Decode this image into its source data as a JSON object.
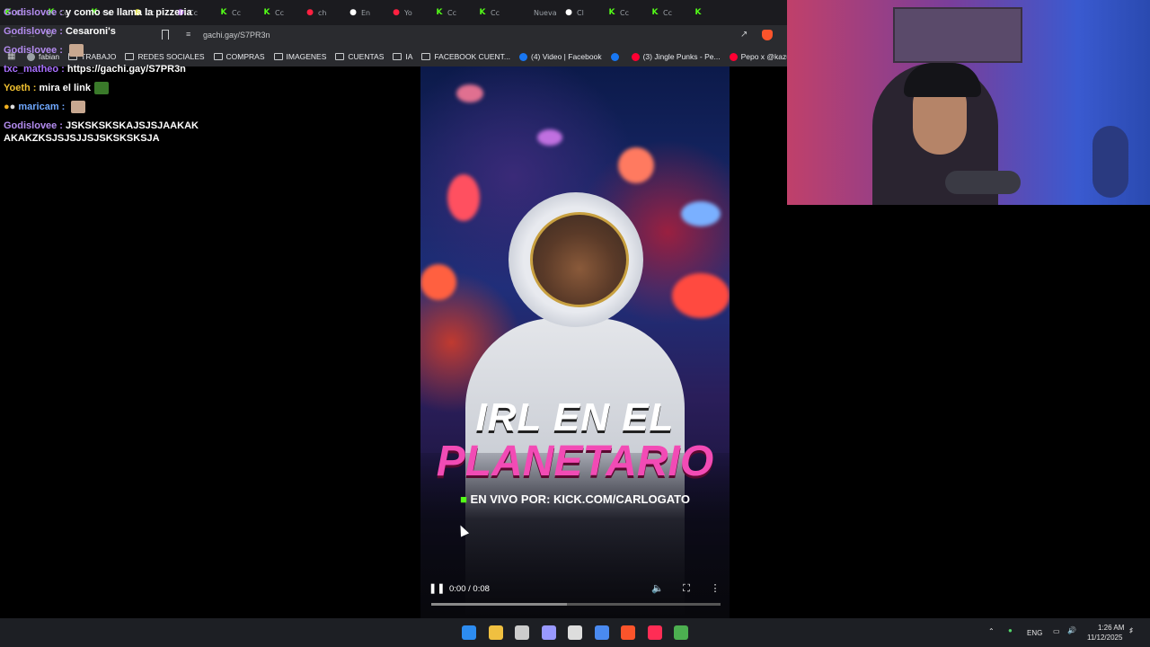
{
  "browser": {
    "tabs": [
      {
        "label": "Cc",
        "icon": "kick-icon",
        "color": "#53fc18"
      },
      {
        "label": "Cc",
        "icon": "kick-icon",
        "color": "#53fc18"
      },
      {
        "label": "Cc",
        "icon": "kick-icon",
        "color": "#53fc18"
      },
      {
        "label": "Cc",
        "icon": "star-icon",
        "color": "#e0e040"
      },
      {
        "label": "Cc",
        "icon": "feather-icon",
        "color": "#b070e0"
      },
      {
        "label": "Cc",
        "icon": "kick-icon",
        "color": "#53fc18"
      },
      {
        "label": "Cc",
        "icon": "kick-icon",
        "color": "#53fc18"
      },
      {
        "label": "ch",
        "icon": "youtube-icon",
        "color": "#ff2040"
      },
      {
        "label": "En",
        "icon": "tiktok-icon",
        "color": "#ffffff"
      },
      {
        "label": "Yo",
        "icon": "youtube-icon",
        "color": "#ff2040"
      },
      {
        "label": "Cc",
        "icon": "kick-icon",
        "color": "#53fc18"
      },
      {
        "label": "Cc",
        "icon": "kick-icon",
        "color": "#53fc18"
      },
      {
        "label": "Nueva",
        "icon": "",
        "color": "#9aa0a6"
      },
      {
        "label": "Cl",
        "icon": "chatgpt-icon",
        "color": "#ffffff"
      },
      {
        "label": "Cc",
        "icon": "kick-icon",
        "color": "#53fc18"
      },
      {
        "label": "Cc",
        "icon": "kick-icon",
        "color": "#53fc18"
      },
      {
        "label": "",
        "icon": "kick-icon",
        "color": "#53fc18"
      }
    ],
    "url": "gachi.gay/S7PR3n",
    "bookmarks": [
      {
        "label": "fabian",
        "type": "site"
      },
      {
        "label": "TRABAJO",
        "type": "folder"
      },
      {
        "label": "REDES SOCIALES",
        "type": "folder"
      },
      {
        "label": "COMPRAS",
        "type": "folder"
      },
      {
        "label": "IMAGENES",
        "type": "folder"
      },
      {
        "label": "CUENTAS",
        "type": "folder"
      },
      {
        "label": "IA",
        "type": "folder"
      },
      {
        "label": "FACEBOOK CUENT...",
        "type": "folder"
      },
      {
        "label": "(4) Video | Facebook",
        "type": "facebook"
      },
      {
        "label": "",
        "type": "facebook"
      },
      {
        "label": "(3) Jingle Punks - Pe...",
        "type": "youtube"
      },
      {
        "label": "Pepo x @kazu.oficia...",
        "type": "youtube"
      }
    ]
  },
  "chat": {
    "messages": [
      {
        "user": "Godislovee",
        "text": "y como se llama la pizzeria",
        "color": "#b48cf0"
      },
      {
        "user": "Godislovee",
        "text": "Cesaroni's",
        "color": "#b48cf0"
      },
      {
        "user": "Godislovee",
        "text": "",
        "color": "#b48cf0",
        "emote": true
      },
      {
        "user": "txc_matheo",
        "text": "https://gachi.gay/S7PR3n",
        "color": "#a970ff"
      },
      {
        "user": "Yoeth",
        "text": "mira el link",
        "color": "#f0c030",
        "emote": true
      },
      {
        "user": "maricam",
        "text": "",
        "color": "#6fa8ff",
        "emote": true,
        "badges": true
      },
      {
        "user": "Godislovee",
        "text": "JSKSKSKSKAJSJSJAAKAK",
        "color": "#b48cf0"
      },
      {
        "user": "",
        "text": "AKAKZKSJSJSJJSJSKSKSKSJA",
        "color": "#b48cf0"
      }
    ]
  },
  "video": {
    "title_line1": "IRL EN EL",
    "title_line2": "PLANETARIO",
    "subtitle_prefix": "EN VIVO POR:",
    "subtitle_link": "KICK.COM/CARLOGATO",
    "time": "0:00 / 0:08",
    "buffered": 0.47,
    "played": 0.0
  },
  "taskbar": {
    "language": "ENG",
    "time": "1:26 AM",
    "date": "11/12/2025",
    "apps": [
      {
        "name": "windows-start-icon",
        "color": "#2d8cf0"
      },
      {
        "name": "file-explorer-icon",
        "color": "#f0c040"
      },
      {
        "name": "obs-icon",
        "color": "#cccccc"
      },
      {
        "name": "premiere-icon",
        "color": "#9999ff"
      },
      {
        "name": "epic-games-icon",
        "color": "#dddddd"
      },
      {
        "name": "chrome-color-icon",
        "color": "#4a8af0"
      },
      {
        "name": "brave-icon",
        "color": "#fb542b"
      },
      {
        "name": "tiktok-icon",
        "color": "#ff2d55"
      },
      {
        "name": "chrome-icon",
        "color": "#4caf50"
      }
    ]
  }
}
